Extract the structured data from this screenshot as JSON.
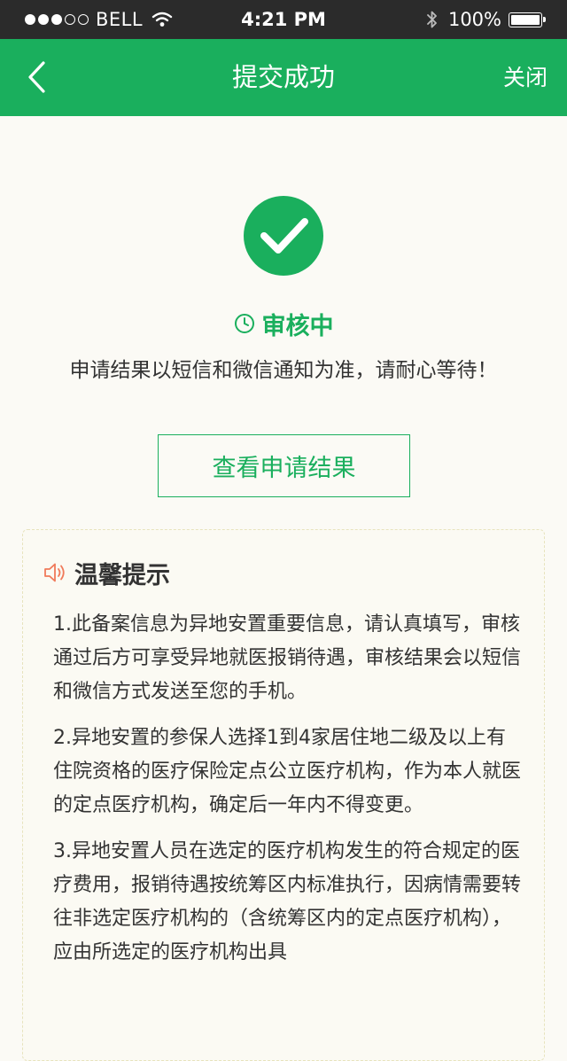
{
  "status_bar": {
    "carrier": "BELL",
    "time": "4:21 PM",
    "battery": "100%"
  },
  "nav": {
    "title": "提交成功",
    "close_label": "关闭"
  },
  "result": {
    "status": "审核中",
    "message": "申请结果以短信和微信通知为准，请耐心等待！",
    "view_button_label": "查看申请结果"
  },
  "tips": {
    "title": "温馨提示",
    "items": [
      "1.此备案信息为异地安置重要信息，请认真填写，审核通过后方可享受异地就医报销待遇，审核结果会以短信和微信方式发送至您的手机。",
      "2.异地安置的参保人选择1到4家居住地二级及以上有住院资格的医疗保险定点公立医疗机构，作为本人就医的定点医疗机构，确定后一年内不得变更。",
      "3.异地安置人员在选定的医疗机构发生的符合规定的医疗费用，报销待遇按统筹区内标准执行，因病情需要转往非选定医疗机构的（含统筹区内的定点医疗机构），应由所选定的医疗机构出具"
    ]
  },
  "colors": {
    "primary_green": "#1aaf5d",
    "status_bar_bg": "#2b2b2b",
    "speaker_icon": "#f07a5a",
    "card_border": "#e7e3bd"
  },
  "icons": [
    "back-arrow-icon",
    "wifi-icon",
    "bluetooth-icon",
    "battery-icon",
    "checkmark-circle-icon",
    "clock-icon",
    "speaker-icon"
  ]
}
